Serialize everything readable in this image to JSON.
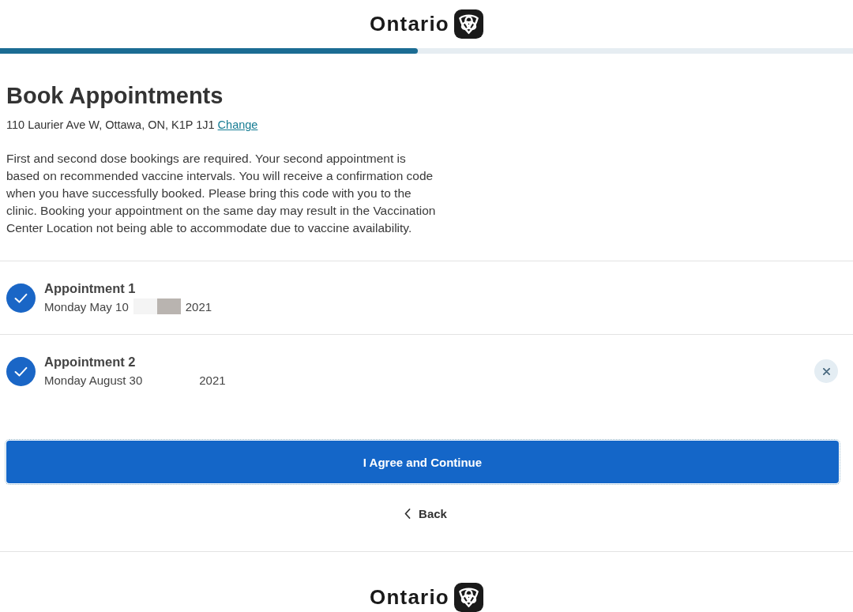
{
  "header": {
    "logo_text": "Ontario"
  },
  "progress": {
    "level": 0.49
  },
  "title": "Book Appointments",
  "address": {
    "text": "110 Laurier Ave W, Ottawa, ON, K1P 1J1",
    "link": "Change"
  },
  "intro": "First and second dose bookings are required. Your second appointment is based on recommended vaccine intervals. You will receive a confirmation code when you have successfully booked. Please bring this code with you to the clinic. Booking your appointment on the same day may result in the Vaccination Center Location not being able to accommodate due to vaccine availability.",
  "appointments": [
    {
      "title": "Appointment 1",
      "date": "Monday May 10",
      "year": "2021",
      "confirmed": true,
      "redacted": true,
      "removable": false
    },
    {
      "title": "Appointment 2",
      "date": "Monday August 30",
      "year": "2021",
      "confirmed": true,
      "redacted": false,
      "removable": true
    }
  ],
  "primary_button": "I Agree and Continue",
  "back_link": "Back",
  "footer": {
    "logo_text": "Ontario"
  }
}
